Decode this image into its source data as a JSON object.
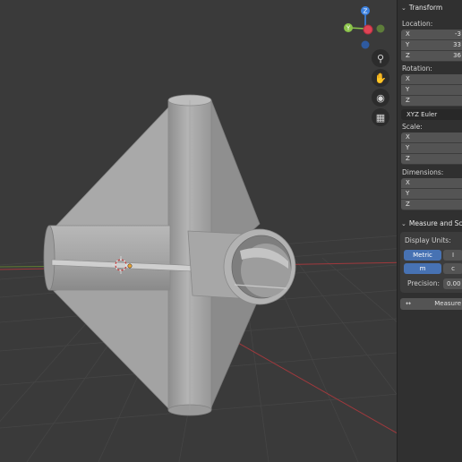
{
  "gizmo": {
    "z_label": "Z",
    "y_label": "Y",
    "colors": {
      "x": "#e04455",
      "y": "#8bc34a",
      "z": "#3d82e0",
      "neg_x": "#9a3a44",
      "neg_y": "#5e7d3a",
      "neg_z": "#2e5aa0"
    }
  },
  "nav_tools": [
    {
      "icon": "zoom-icon",
      "glyph": "⚲"
    },
    {
      "icon": "pan-hand-icon",
      "glyph": "✋"
    },
    {
      "icon": "camera-icon",
      "glyph": "◉"
    },
    {
      "icon": "grid-perspective-icon",
      "glyph": "▦"
    }
  ],
  "transform": {
    "header": "Transform",
    "location_label": "Location:",
    "location": [
      {
        "axis": "X",
        "value": "-3"
      },
      {
        "axis": "Y",
        "value": "33"
      },
      {
        "axis": "Z",
        "value": "36"
      }
    ],
    "rotation_label": "Rotation:",
    "rotation": [
      {
        "axis": "X",
        "value": ""
      },
      {
        "axis": "Y",
        "value": ""
      },
      {
        "axis": "Z",
        "value": ""
      }
    ],
    "rotation_mode": "XYZ Euler",
    "scale_label": "Scale:",
    "scale": [
      {
        "axis": "X",
        "value": ""
      },
      {
        "axis": "Y",
        "value": ""
      },
      {
        "axis": "Z",
        "value": ""
      }
    ],
    "dimensions_label": "Dimensions:",
    "dimensions": [
      {
        "axis": "X",
        "value": ""
      },
      {
        "axis": "Y",
        "value": ""
      },
      {
        "axis": "Z",
        "value": ""
      }
    ]
  },
  "measure": {
    "header": "Measure and Scale",
    "display_units_label": "Display Units:",
    "unit_system": [
      {
        "label": "Metric",
        "active": true
      },
      {
        "label": "I",
        "active": false
      }
    ],
    "unit": [
      {
        "label": "m",
        "active": true
      },
      {
        "label": "c",
        "active": false
      }
    ],
    "precision_label": "Precision:",
    "precision_value": "0.00",
    "measure_button": "Measure",
    "measure_icon": "↔"
  },
  "colors": {
    "x_axis": "#a0393d",
    "y_axis": "#7a9a32",
    "grid": "#444444",
    "background": "#3a3a3a",
    "active": "#4772b3"
  }
}
